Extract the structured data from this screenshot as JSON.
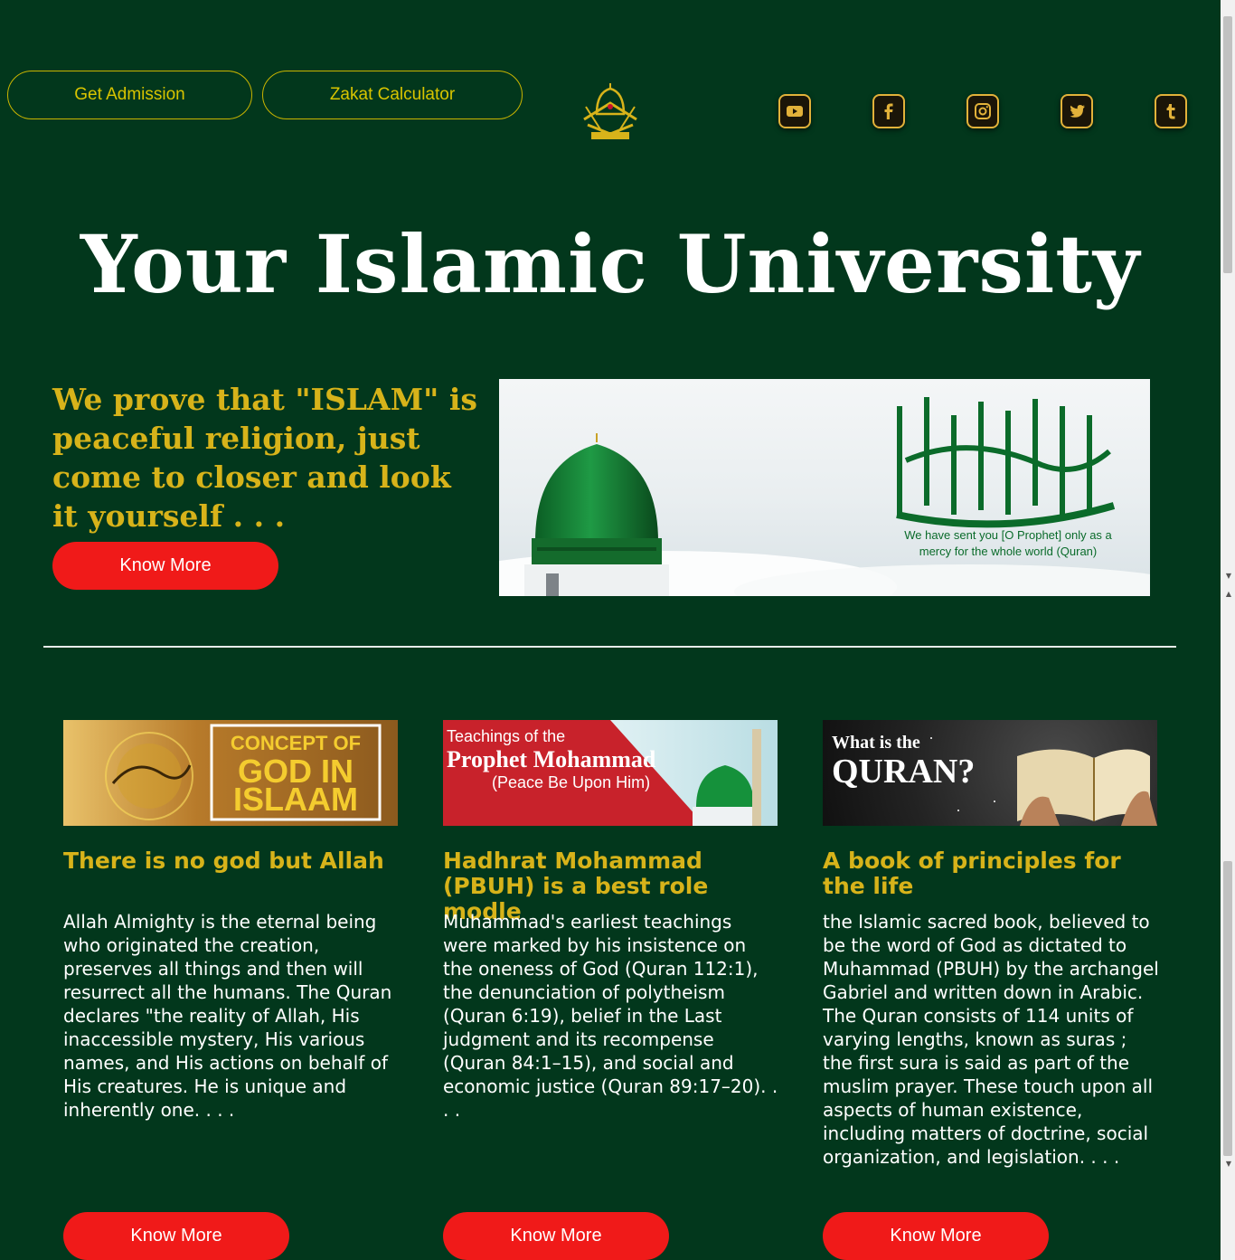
{
  "header": {
    "admission_label": "Get Admission",
    "zakat_label": "Zakat Calculator",
    "social": [
      "youtube-icon",
      "facebook-icon",
      "instagram-icon",
      "twitter-icon",
      "tumblr-icon"
    ]
  },
  "hero": {
    "title": "Your Islamic University",
    "tagline": "We prove that \"ISLAM\" is peaceful religion, just come to closer and look it yourself . . .",
    "button_label": "Know More",
    "banner_caption": "We have sent you [O Prophet] only as a mercy for the whole world (Quran)"
  },
  "cards": [
    {
      "image_line1": "CONCEPT OF",
      "image_line2": "GOD IN",
      "image_line3": "ISLAAM",
      "title": "There is no god but Allah",
      "text": "Allah Almighty is the eternal being who originated the creation, preserves all things and then will resurrect all the humans. The Quran declares \"the reality of Allah, His inaccessible mystery, His various names, and His actions on behalf of His creatures. He is unique and inherently one. . . .",
      "button_label": "Know More"
    },
    {
      "image_line1": "Teachings of the",
      "image_line2": "Prophet Mohammad",
      "image_line3": "(Peace Be Upon Him)",
      "title": "Hadhrat Mohammad (PBUH) is a best role modle",
      "text": "Muhammad's earliest teachings were marked by his insistence on the oneness of God (Quran 112:1), the denunciation of polytheism (Quran 6:19), belief in the Last judgment and its recompense (Quran 84:1–15), and social and economic justice (Quran 89:17–20). . . .",
      "button_label": "Know More"
    },
    {
      "image_line1": "What is the",
      "image_line2": "QURAN?",
      "title": "A book of principles for the life",
      "text": "the Islamic sacred book, believed to be the word of God as dictated to Muhammad (PBUH) by the archangel Gabriel and written down in Arabic. The Quran consists of 114 units of varying lengths, known as suras ; the first sura is said as part of the muslim prayer. These touch upon all aspects of human existence, including matters of doctrine, social organization, and legislation. . . .",
      "button_label": "Know More"
    }
  ]
}
